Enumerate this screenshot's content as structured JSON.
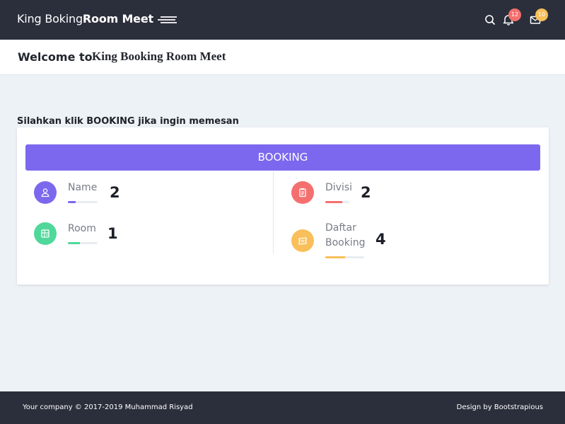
{
  "header": {
    "brand_light": "King Boking",
    "brand_bold": "Room Meet",
    "notifications_count": "12",
    "messages_count": "10"
  },
  "welcome": {
    "prefix": "Welcome to",
    "title": "King Booking Room Meet"
  },
  "instruction": "Silahkan klik BOOKING jika ingin memesan",
  "booking_button": "BOOKING",
  "stats": [
    {
      "label": "Name",
      "value": "2",
      "progress": 0.25,
      "color": "#7b68ee",
      "icon": "user-icon"
    },
    {
      "label": "Room",
      "value": "1",
      "progress": 0.4,
      "color": "#4fd89a",
      "icon": "room-icon"
    },
    {
      "label": "Divisi",
      "value": "2",
      "progress": 0.7,
      "color": "#f4706f",
      "icon": "clipboard-icon"
    },
    {
      "label_line1": "Daftar",
      "label_line2": "Booking",
      "value": "4",
      "progress": 0.5,
      "color": "#f9bf5a",
      "icon": "ticket-icon"
    }
  ],
  "footer": {
    "left": "Your company © 2017-2019 Muhammad Risyad",
    "right": "Design by Bootstrapious"
  },
  "colors": {
    "topbar": "#2b2f3b",
    "accent": "#7b68ee",
    "background": "#edf2f6",
    "badge_red": "#f4706f",
    "badge_orange": "#f9bf5a"
  }
}
